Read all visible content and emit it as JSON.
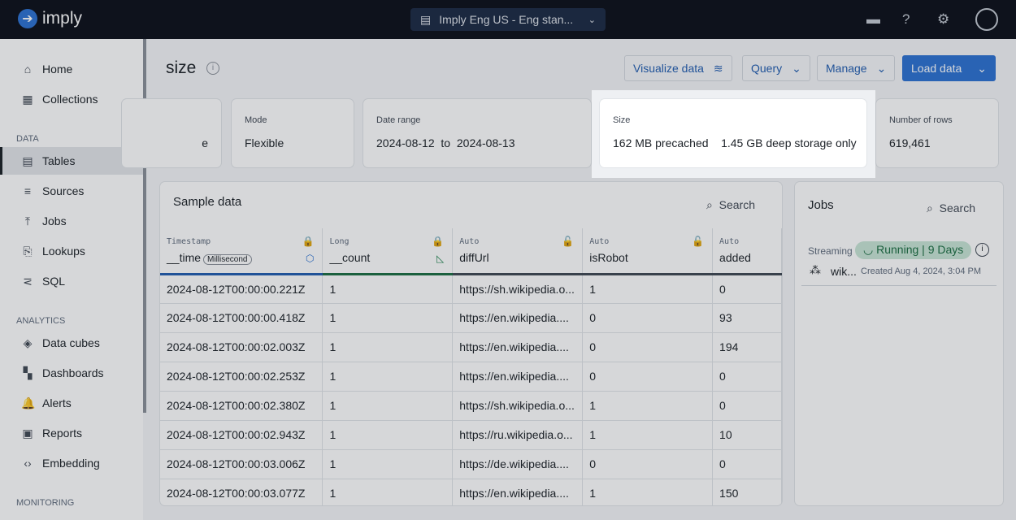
{
  "topbar": {
    "logo": "imply",
    "environment": "Imply Eng US - Eng stan..."
  },
  "sidebar": {
    "items": [
      {
        "label": "Home",
        "icon": "home-icon"
      },
      {
        "label": "Collections",
        "icon": "grid-icon"
      }
    ],
    "sections": [
      {
        "title": "DATA",
        "items": [
          {
            "label": "Tables",
            "icon": "table-icon",
            "active": true
          },
          {
            "label": "Sources",
            "icon": "database-icon"
          },
          {
            "label": "Jobs",
            "icon": "upload-icon"
          },
          {
            "label": "Lookups",
            "icon": "lookup-icon"
          },
          {
            "label": "SQL",
            "icon": "sql-icon"
          }
        ]
      },
      {
        "title": "ANALYTICS",
        "items": [
          {
            "label": "Data cubes",
            "icon": "cube-icon"
          },
          {
            "label": "Dashboards",
            "icon": "dashboard-icon"
          },
          {
            "label": "Alerts",
            "icon": "bell-icon"
          },
          {
            "label": "Reports",
            "icon": "report-icon"
          },
          {
            "label": "Embedding",
            "icon": "code-icon"
          }
        ]
      },
      {
        "title": "MONITORING",
        "items": []
      }
    ]
  },
  "page": {
    "title": "size",
    "buttons": {
      "visualize": "Visualize data",
      "query": "Query",
      "manage": "Manage",
      "load": "Load data"
    }
  },
  "cards": {
    "partial": "e",
    "mode": {
      "label": "Mode",
      "value": "Flexible"
    },
    "date_range": {
      "label": "Date range",
      "from": "2024-08-12",
      "to_word": "to",
      "to": "2024-08-13"
    },
    "size": {
      "label": "Size",
      "precached": "162 MB precached",
      "deep": "1.45 GB deep storage only"
    },
    "rows": {
      "label": "Number of rows",
      "value": "619,461"
    }
  },
  "sample": {
    "title": "Sample data",
    "search": "Search",
    "columns": [
      {
        "type": "Timestamp",
        "name": "__time",
        "badge": "Millisecond"
      },
      {
        "type": "Long",
        "name": "__count"
      },
      {
        "type": "Auto",
        "name": "diffUrl"
      },
      {
        "type": "Auto",
        "name": "isRobot"
      },
      {
        "type": "Auto",
        "name": "added"
      }
    ],
    "rows": [
      [
        "2024-08-12T00:00:00.221Z",
        "1",
        "https://sh.wikipedia.o...",
        "1",
        "0"
      ],
      [
        "2024-08-12T00:00:00.418Z",
        "1",
        "https://en.wikipedia....",
        "0",
        "93"
      ],
      [
        "2024-08-12T00:00:02.003Z",
        "1",
        "https://en.wikipedia....",
        "0",
        "194"
      ],
      [
        "2024-08-12T00:00:02.253Z",
        "1",
        "https://en.wikipedia....",
        "0",
        "0"
      ],
      [
        "2024-08-12T00:00:02.380Z",
        "1",
        "https://sh.wikipedia.o...",
        "1",
        "0"
      ],
      [
        "2024-08-12T00:00:02.943Z",
        "1",
        "https://ru.wikipedia.o...",
        "1",
        "10"
      ],
      [
        "2024-08-12T00:00:03.006Z",
        "1",
        "https://de.wikipedia....",
        "0",
        "0"
      ],
      [
        "2024-08-12T00:00:03.077Z",
        "1",
        "https://en.wikipedia....",
        "1",
        "150"
      ]
    ]
  },
  "jobs": {
    "title": "Jobs",
    "search": "Search",
    "job": {
      "type": "Streaming",
      "status": "Running",
      "duration": "9 Days",
      "name": "wik...",
      "created": "Created Aug 4, 2024, 3:04 PM"
    }
  }
}
